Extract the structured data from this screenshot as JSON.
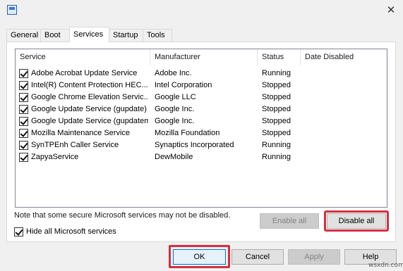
{
  "window": {
    "close_glyph": "✕"
  },
  "tabs": [
    {
      "label": "General",
      "active": false
    },
    {
      "label": "Boot",
      "active": false
    },
    {
      "label": "Services",
      "active": true
    },
    {
      "label": "Startup",
      "active": false
    },
    {
      "label": "Tools",
      "active": false
    }
  ],
  "services_table": {
    "columns": [
      "Service",
      "Manufacturer",
      "Status",
      "Date Disabled"
    ],
    "rows": [
      {
        "checked": true,
        "service": "Adobe Acrobat Update Service",
        "manufacturer": "Adobe Inc.",
        "status": "Running",
        "date_disabled": ""
      },
      {
        "checked": true,
        "service": "Intel(R) Content Protection HEC...",
        "manufacturer": "Intel Corporation",
        "status": "Stopped",
        "date_disabled": ""
      },
      {
        "checked": true,
        "service": "Google Chrome Elevation Servic...",
        "manufacturer": "Google LLC",
        "status": "Stopped",
        "date_disabled": ""
      },
      {
        "checked": true,
        "service": "Google Update Service (gupdate)",
        "manufacturer": "Google Inc.",
        "status": "Stopped",
        "date_disabled": ""
      },
      {
        "checked": true,
        "service": "Google Update Service (gupdatem)",
        "manufacturer": "Google Inc.",
        "status": "Stopped",
        "date_disabled": ""
      },
      {
        "checked": true,
        "service": "Mozilla Maintenance Service",
        "manufacturer": "Mozilla Foundation",
        "status": "Stopped",
        "date_disabled": ""
      },
      {
        "checked": true,
        "service": "SynTPEnh Caller Service",
        "manufacturer": "Synaptics Incorporated",
        "status": "Running",
        "date_disabled": ""
      },
      {
        "checked": true,
        "service": "ZapyaService",
        "manufacturer": "DewMobile",
        "status": "Running",
        "date_disabled": ""
      }
    ]
  },
  "note": "Note that some secure Microsoft services may not be disabled.",
  "buttons": {
    "enable_all": "Enable all",
    "disable_all": "Disable all",
    "ok": "OK",
    "cancel": "Cancel",
    "apply": "Apply",
    "help": "Help"
  },
  "hide_ms": {
    "label": "Hide all Microsoft services",
    "checked": true
  },
  "watermark": "wsxdn.com",
  "colors": {
    "highlight": "#d32f3f",
    "accent": "#0078d7"
  }
}
